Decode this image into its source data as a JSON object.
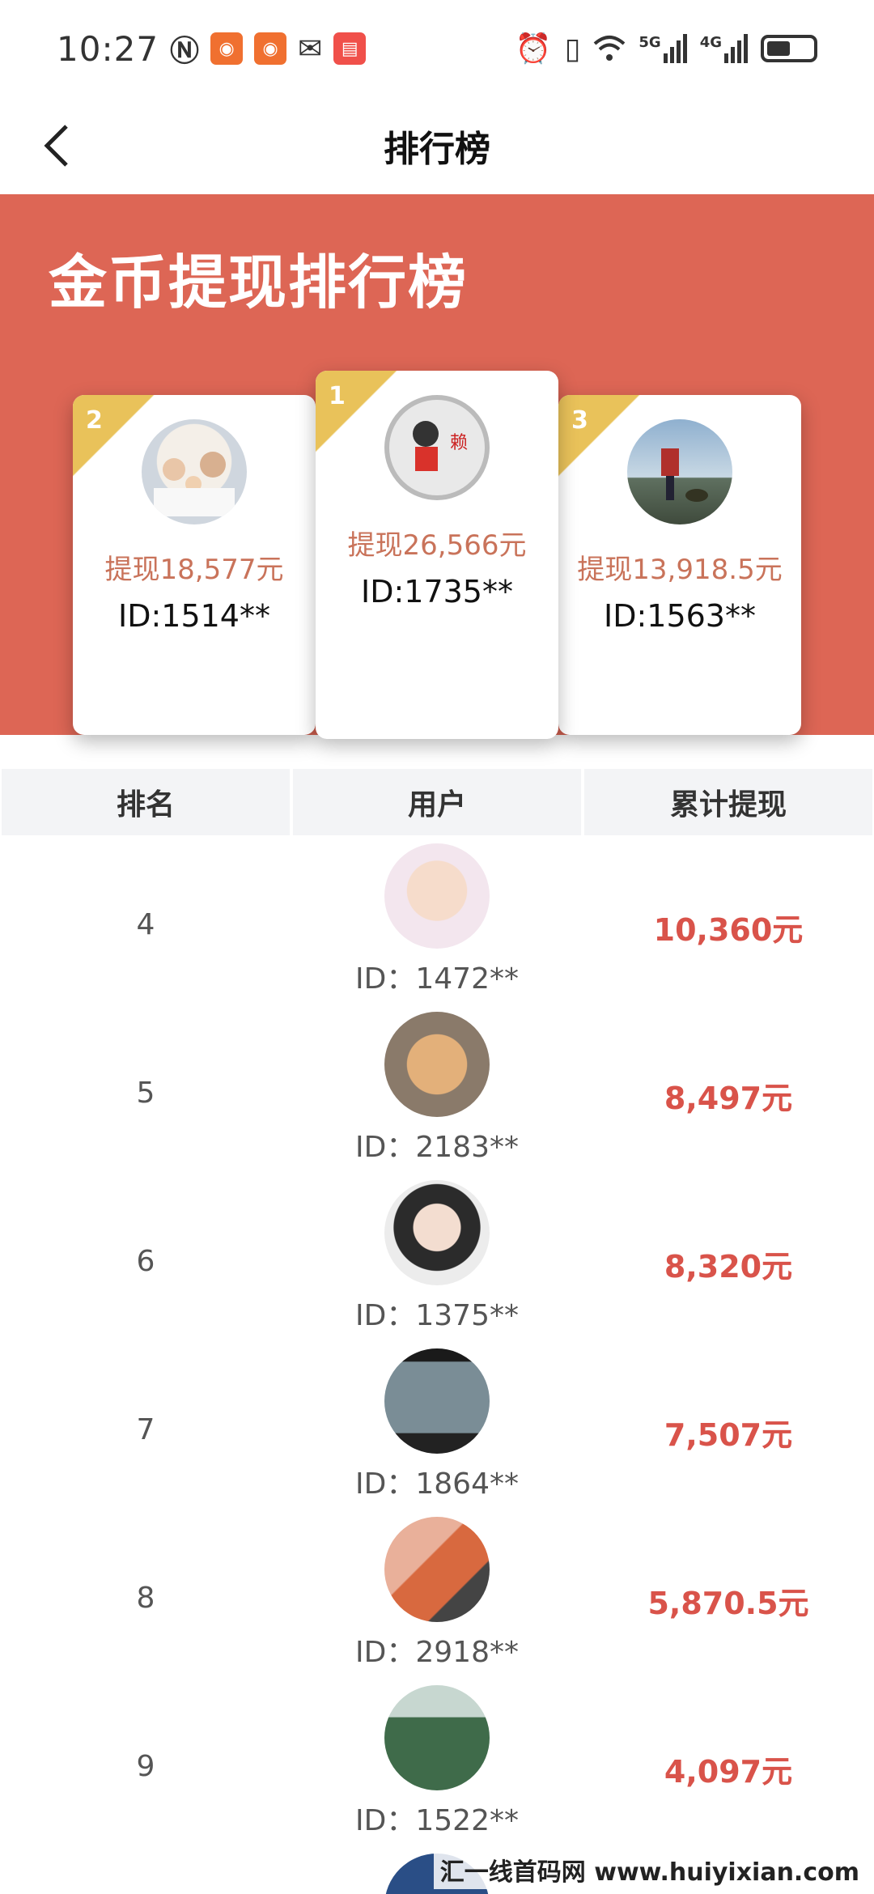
{
  "status_bar": {
    "time": "10:27",
    "icons": [
      "nfc-icon",
      "app-icon",
      "app-icon",
      "wechat-icon",
      "app-icon",
      "alarm-icon",
      "vibrate-icon",
      "wifi-icon",
      "5g-signal-icon",
      "4g-signal-icon",
      "battery-icon"
    ],
    "signal_5g": "5G",
    "signal_4g": "4G"
  },
  "nav": {
    "title": "排行榜"
  },
  "hero": {
    "title": "金币提现排行榜"
  },
  "colors": {
    "hero_bg": "#dd6655",
    "ribbon": "#e9c25a",
    "amount": "#d9534a",
    "card_amount": "#c9735a"
  },
  "podium": [
    {
      "rank": "1",
      "amount": "提现26,566元",
      "id": "ID:1735**"
    },
    {
      "rank": "2",
      "amount": "提现18,577元",
      "id": "ID:1514**"
    },
    {
      "rank": "3",
      "amount": "提现13,918.5元",
      "id": "ID:1563**"
    }
  ],
  "table": {
    "headers": [
      "排名",
      "用户",
      "累计提现"
    ],
    "rows": [
      {
        "rank": "4",
        "id": "ID：1472**",
        "amount": "10,360元"
      },
      {
        "rank": "5",
        "id": "ID：2183**",
        "amount": "8,497元"
      },
      {
        "rank": "6",
        "id": "ID：1375**",
        "amount": "8,320元"
      },
      {
        "rank": "7",
        "id": "ID：1864**",
        "amount": "7,507元"
      },
      {
        "rank": "8",
        "id": "ID：2918**",
        "amount": "5,870.5元"
      },
      {
        "rank": "9",
        "id": "ID：1522**",
        "amount": "4,097元"
      }
    ]
  },
  "watermark": "汇一线首码网 www.huiyixian.com"
}
